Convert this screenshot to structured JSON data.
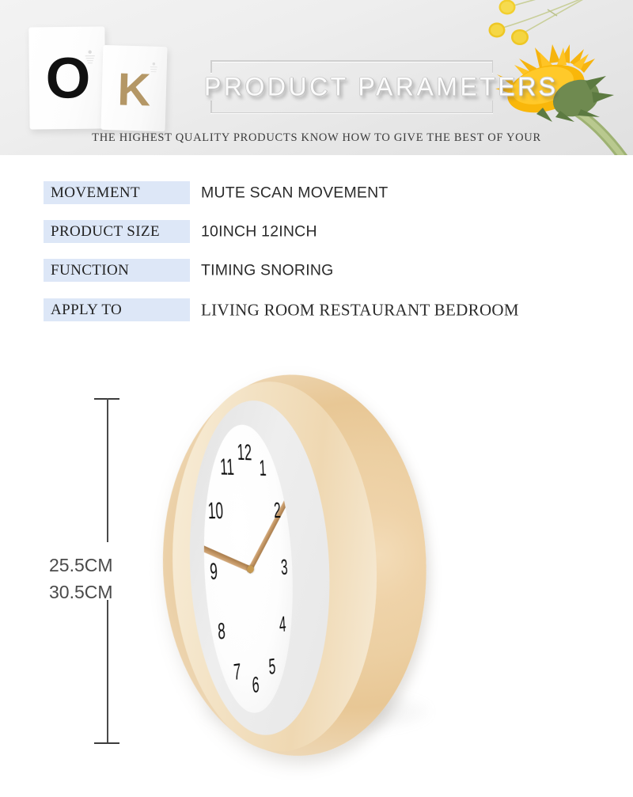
{
  "banner": {
    "title": "PRODUCT PARAMETERS",
    "subtitle": "THE HIGHEST QUALITY PRODUCTS KNOW HOW TO GIVE THE BEST OF YOUR",
    "card_o_letter": "O",
    "card_k_letter": "K",
    "accent_gold": "#b49766",
    "band_bg": "#ececec",
    "icons": [
      "sunflower-icon",
      "billy-button-flower-icon"
    ]
  },
  "spec_table": {
    "label_bg": "#dde7f7",
    "rows": [
      {
        "label": "MOVEMENT",
        "value": "MUTE SCAN MOVEMENT",
        "serif_value": false
      },
      {
        "label": "PRODUCT SIZE",
        "value": "10INCH 12INCH",
        "serif_value": false
      },
      {
        "label": "FUNCTION",
        "value": "TIMING SNORING",
        "serif_value": false
      },
      {
        "label": "APPLY TO",
        "value": "LIVING ROOM RESTAURANT BEDROOM",
        "serif_value": true
      }
    ]
  },
  "dimension": {
    "line_1": "25.5CM",
    "line_2": "30.5CM"
  },
  "clock": {
    "numerals": [
      "12",
      "1",
      "2",
      "3",
      "4",
      "5",
      "6",
      "7",
      "8",
      "9",
      "10",
      "11"
    ],
    "frame_color": "#edd3a8",
    "face_color": "#ffffff",
    "hand_color": "#c09361",
    "time_hour": "10",
    "time_minute": "10"
  }
}
